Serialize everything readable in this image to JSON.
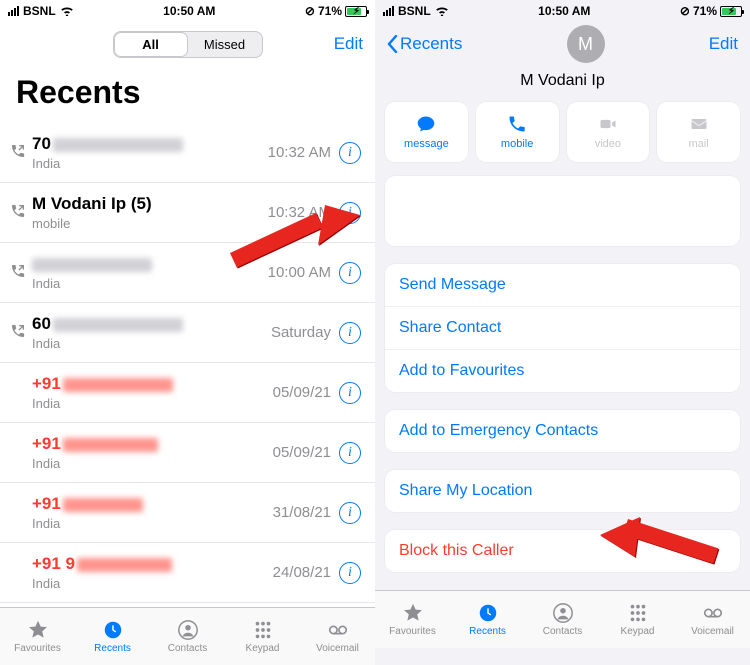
{
  "status": {
    "carrier": "BSNL",
    "time": "10:50 AM",
    "battery": "71%"
  },
  "left": {
    "seg_all": "All",
    "seg_missed": "Missed",
    "edit": "Edit",
    "title": "Recents",
    "calls": [
      {
        "name": "70",
        "sub": "India",
        "time": "10:32 AM",
        "missed": false,
        "out": true,
        "blurW": 130
      },
      {
        "name": "M Vodani Ip (5)",
        "sub": "mobile",
        "time": "10:32 AM",
        "missed": false,
        "out": true,
        "blurW": 0
      },
      {
        "name": "",
        "sub": "India",
        "time": "10:00 AM",
        "missed": false,
        "out": true,
        "blurW": 120
      },
      {
        "name": "60",
        "sub": "India",
        "time": "Saturday",
        "missed": false,
        "out": true,
        "blurW": 130
      },
      {
        "name": "+91",
        "sub": "India",
        "time": "05/09/21",
        "missed": true,
        "out": false,
        "blurW": 110
      },
      {
        "name": "+91",
        "sub": "India",
        "time": "05/09/21",
        "missed": true,
        "out": false,
        "blurW": 95
      },
      {
        "name": "+91",
        "sub": "India",
        "time": "31/08/21",
        "missed": true,
        "out": false,
        "blurW": 80
      },
      {
        "name": "+91 9",
        "sub": "India",
        "time": "24/08/21",
        "missed": true,
        "out": false,
        "blurW": 95
      }
    ]
  },
  "right": {
    "back": "Recents",
    "edit": "Edit",
    "avatar_initial": "M",
    "contact_name": "M Vodani Ip",
    "actions": {
      "message": "message",
      "mobile": "mobile",
      "video": "video",
      "mail": "mail"
    },
    "group1": [
      "Send Message",
      "Share Contact",
      "Add to Favourites"
    ],
    "group2": [
      "Add to Emergency Contacts"
    ],
    "group3": [
      "Share My Location"
    ],
    "group4": [
      "Block this Caller"
    ]
  },
  "tabs": {
    "favourites": "Favourites",
    "recents": "Recents",
    "contacts": "Contacts",
    "keypad": "Keypad",
    "voicemail": "Voicemail"
  }
}
